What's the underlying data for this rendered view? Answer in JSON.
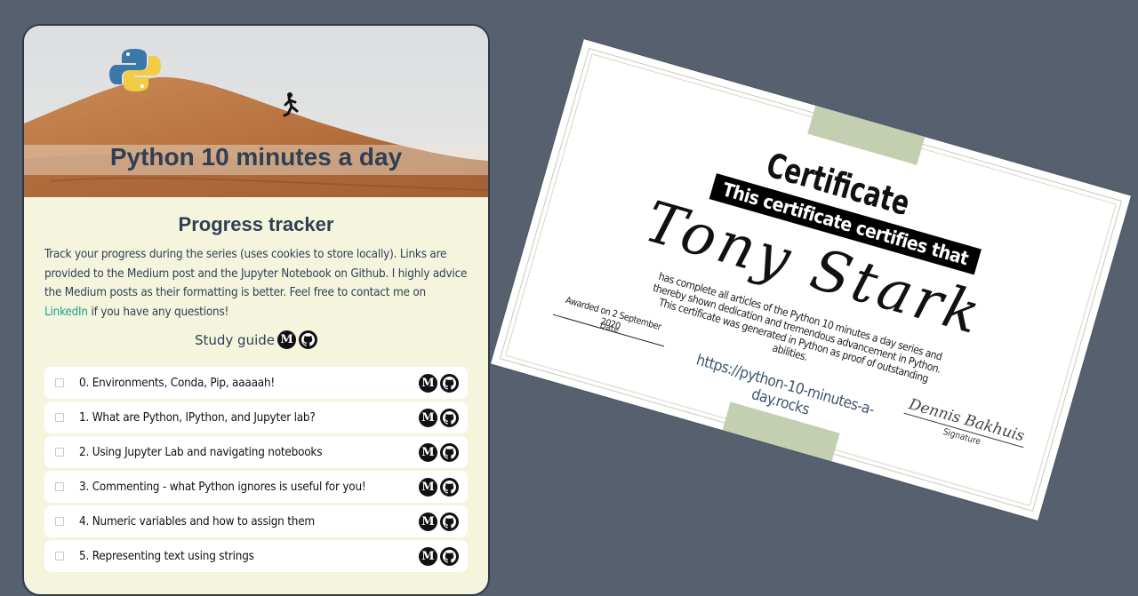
{
  "header": {
    "title": "Python 10 minutes a day"
  },
  "tracker": {
    "heading": "Progress tracker",
    "intro_before_link": "Track your progress during the series (uses cookies to store locally). Links are provided to the Medium post and the Jupyter Notebook on Github. I highly advice the Medium posts as their formatting is better. Feel free to contact me on ",
    "intro_link": "LinkedIn",
    "intro_after_link": " if you have any questions!",
    "study_guide_label": "Study guide"
  },
  "icons": {
    "medium": "medium-icon",
    "github": "github-icon",
    "medium_glyph": "M"
  },
  "lessons": [
    {
      "label": "0. Environments, Conda, Pip, aaaaah!",
      "checked": false
    },
    {
      "label": "1. What are Python, IPython, and Jupyter lab?",
      "checked": false
    },
    {
      "label": "2. Using Jupyter Lab and navigating notebooks",
      "checked": false
    },
    {
      "label": "3. Commenting - what Python ignores is useful for you!",
      "checked": false
    },
    {
      "label": "4. Numeric variables and how to assign them",
      "checked": false
    },
    {
      "label": "5. Representing text using strings",
      "checked": false
    }
  ],
  "certificate": {
    "title": "Certificate",
    "banner": "This certificate certifies that",
    "name": "Tony Stark",
    "body_line1": "has complete all articles of the Python 10 minutes a day series and",
    "body_line2": "thereby shown dedication and tremendous advancement in Python.",
    "body_line3": "This certificate was generated in Python as proof of outstanding abilities.",
    "awarded": "Awarded on 2 September 2020",
    "date_label": "Date",
    "url": "https://python-10-minutes-a-day.rocks",
    "signature": "Dennis Bakhuis",
    "signature_label": "Signature"
  },
  "colors": {
    "background": "#56606f",
    "card": "#f5f4dd",
    "title_text": "#2f3f55",
    "link": "#1aa38b",
    "ribbon": "#c4cfb1"
  }
}
